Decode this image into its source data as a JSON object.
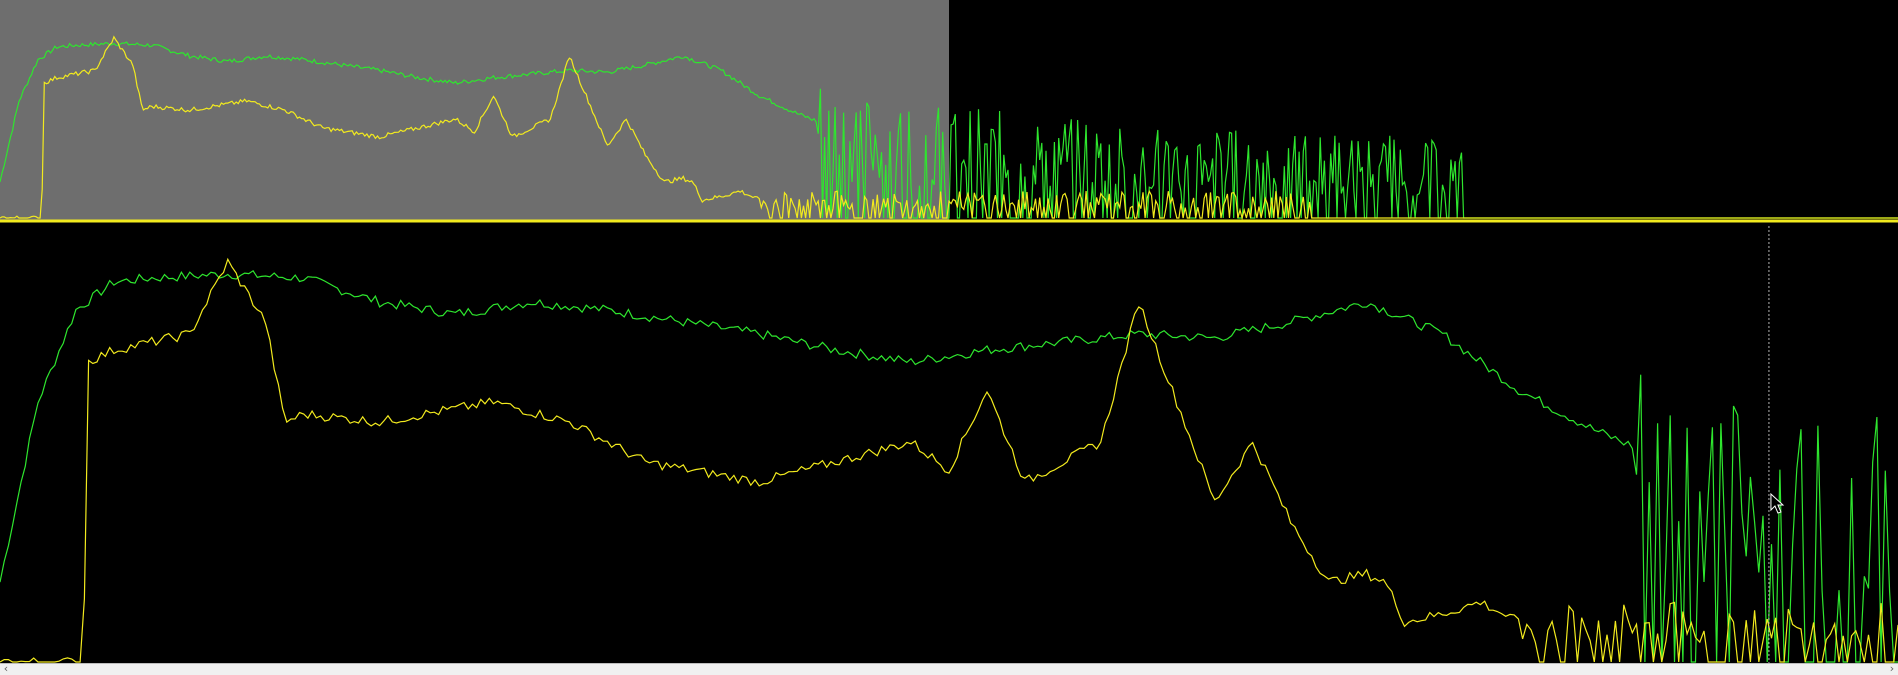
{
  "colors": {
    "background": "#000000",
    "viewport_region": "#6e6e6e",
    "series_green": "#2ee62e",
    "series_yellow": "#f2ea1e",
    "baseline": "#f2ea1e",
    "cursor_line": "#b4b4b4"
  },
  "overview": {
    "viewport_start_fraction": 0.0,
    "viewport_end_fraction": 0.5
  },
  "cursor": {
    "channel_fraction": 0.466
  },
  "scrollbar": {
    "left_arrow_icon": "chevron-left-icon",
    "right_arrow_icon": "chevron-right-icon",
    "left_glyph": "‹",
    "right_glyph": "›"
  },
  "chart_data": {
    "type": "line",
    "channel_range": [
      0,
      1
    ],
    "series": [
      {
        "color": "#2ee62e",
        "x": [
          0.0,
          0.01,
          0.02,
          0.03,
          0.04,
          0.06,
          0.08,
          0.1,
          0.12,
          0.14,
          0.16,
          0.18,
          0.2,
          0.22,
          0.24,
          0.26,
          0.28,
          0.3,
          0.32,
          0.34,
          0.36,
          0.38,
          0.4,
          0.42,
          0.44,
          0.46,
          0.5,
          0.55,
          0.6,
          0.65,
          0.7,
          0.75,
          0.77,
          0.8,
          0.9,
          1.0
        ],
        "values": [
          0.2,
          0.65,
          0.88,
          0.95,
          0.96,
          0.97,
          0.96,
          0.9,
          0.87,
          0.9,
          0.88,
          0.85,
          0.82,
          0.78,
          0.75,
          0.78,
          0.8,
          0.82,
          0.81,
          0.85,
          0.9,
          0.82,
          0.68,
          0.58,
          0.5,
          0.45,
          0.42,
          0.38,
          0.35,
          0.33,
          0.32,
          0.3,
          0.25,
          0.25,
          0.25,
          0.25
        ],
        "noise_start": 0.43,
        "ends_at": 0.77
      },
      {
        "color": "#f2ea1e",
        "x": [
          0.0,
          0.022,
          0.023,
          0.03,
          0.05,
          0.06,
          0.07,
          0.075,
          0.08,
          0.1,
          0.13,
          0.15,
          0.17,
          0.2,
          0.24,
          0.25,
          0.26,
          0.27,
          0.28,
          0.29,
          0.3,
          0.32,
          0.33,
          0.34,
          0.35,
          0.36,
          0.365,
          0.37,
          0.38,
          0.39,
          0.4,
          0.41,
          1.0
        ],
        "values": [
          0.0,
          0.0,
          0.75,
          0.78,
          0.82,
          1.0,
          0.85,
          0.6,
          0.62,
          0.6,
          0.65,
          0.6,
          0.5,
          0.45,
          0.55,
          0.48,
          0.68,
          0.45,
          0.5,
          0.55,
          0.9,
          0.4,
          0.55,
          0.35,
          0.2,
          0.22,
          0.2,
          0.1,
          0.12,
          0.15,
          0.1,
          0.1,
          0.1
        ],
        "noise_start": 0.4,
        "ends_at": 0.69
      }
    ]
  }
}
